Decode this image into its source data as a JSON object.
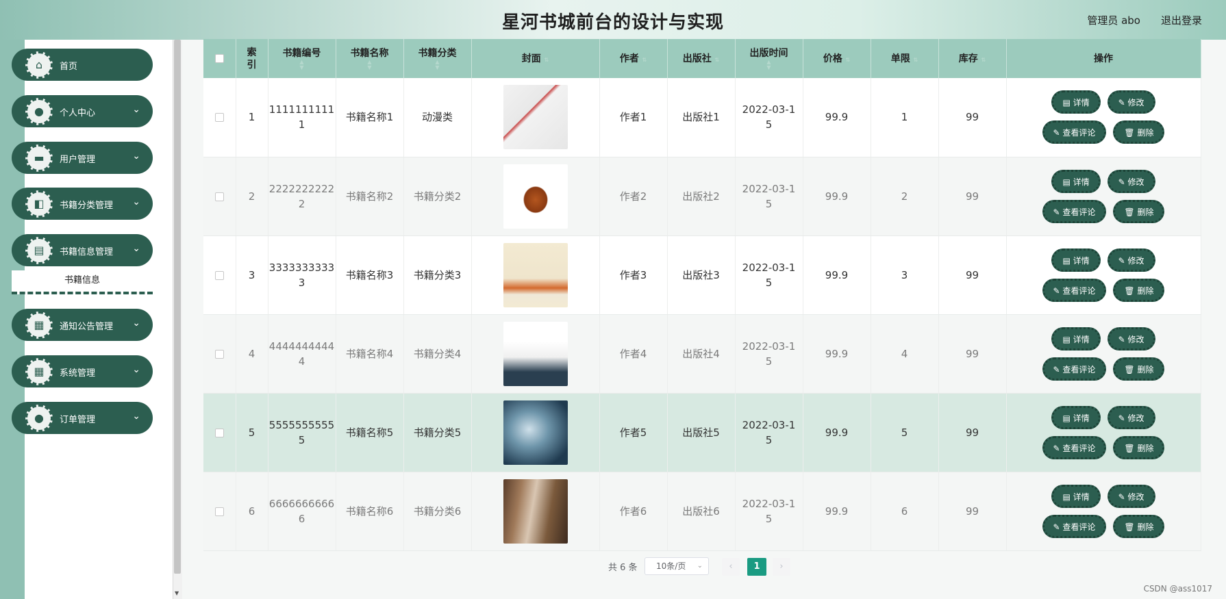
{
  "header": {
    "title": "星河书城前台的设计与实现",
    "user": "管理员 abo",
    "logout": "退出登录"
  },
  "sidebar": {
    "items": [
      {
        "label": "首页",
        "icon": "home-icon",
        "glyph": "⌂",
        "chevron": ""
      },
      {
        "label": "个人中心",
        "icon": "person-icon",
        "glyph": "●",
        "chevron": "⌄"
      },
      {
        "label": "用户管理",
        "icon": "briefcase-icon",
        "glyph": "▬",
        "chevron": "⌄"
      },
      {
        "label": "书籍分类管理",
        "icon": "ticket-icon",
        "glyph": "◧",
        "chevron": "⌄"
      },
      {
        "label": "书籍信息管理",
        "icon": "clipboard-icon",
        "glyph": "▤",
        "chevron": "⌄"
      },
      {
        "label": "通知公告管理",
        "icon": "grid-icon",
        "glyph": "▦",
        "chevron": "⌄"
      },
      {
        "label": "系统管理",
        "icon": "grid-icon",
        "glyph": "▦",
        "chevron": "⌄"
      },
      {
        "label": "订单管理",
        "icon": "person-icon",
        "glyph": "●",
        "chevron": "⌄"
      }
    ],
    "submenu": "书籍信息"
  },
  "table": {
    "columns": [
      "",
      "索\n引",
      "书籍编号",
      "书籍名称",
      "书籍分类",
      "封面",
      "作者",
      "出版社",
      "出版时间",
      "价格",
      "单限",
      "库存",
      "操作"
    ],
    "rows": [
      {
        "index": "1",
        "code": "1111111111",
        "code_tail": "1",
        "name": "书籍名称1",
        "category": "动漫类",
        "author": "作者1",
        "publisher": "出版社1",
        "date": "2022-03-1",
        "date_tail": "5",
        "price": "99.9",
        "limit": "1",
        "stock": "99"
      },
      {
        "index": "2",
        "code": "2222222222",
        "code_tail": "2",
        "name": "书籍名称2",
        "category": "书籍分类2",
        "author": "作者2",
        "publisher": "出版社2",
        "date": "2022-03-1",
        "date_tail": "5",
        "price": "99.9",
        "limit": "2",
        "stock": "99"
      },
      {
        "index": "3",
        "code": "3333333333",
        "code_tail": "3",
        "name": "书籍名称3",
        "category": "书籍分类3",
        "author": "作者3",
        "publisher": "出版社3",
        "date": "2022-03-1",
        "date_tail": "5",
        "price": "99.9",
        "limit": "3",
        "stock": "99"
      },
      {
        "index": "4",
        "code": "4444444444",
        "code_tail": "4",
        "name": "书籍名称4",
        "category": "书籍分类4",
        "author": "作者4",
        "publisher": "出版社4",
        "date": "2022-03-1",
        "date_tail": "5",
        "price": "99.9",
        "limit": "4",
        "stock": "99"
      },
      {
        "index": "5",
        "code": "5555555555",
        "code_tail": "5",
        "name": "书籍名称5",
        "category": "书籍分类5",
        "author": "作者5",
        "publisher": "出版社5",
        "date": "2022-03-1",
        "date_tail": "5",
        "price": "99.9",
        "limit": "5",
        "stock": "99"
      },
      {
        "index": "6",
        "code": "6666666666",
        "code_tail": "6",
        "name": "书籍名称6",
        "category": "书籍分类6",
        "author": "作者6",
        "publisher": "出版社6",
        "date": "2022-03-1",
        "date_tail": "5",
        "price": "99.9",
        "limit": "6",
        "stock": "99"
      }
    ],
    "actions": {
      "detail": "详情",
      "edit": "修改",
      "comments": "查看评论",
      "delete": "删除"
    }
  },
  "pagination": {
    "total": "共 6 条",
    "page_size": "10条/页",
    "current_page": "1"
  },
  "watermark": "CSDN @ass1017",
  "colors": {
    "primary": "#2c5e50",
    "header_row": "#9ccbbd",
    "highlight_row": "#d7e9e1",
    "page_active": "#1a9b82"
  }
}
